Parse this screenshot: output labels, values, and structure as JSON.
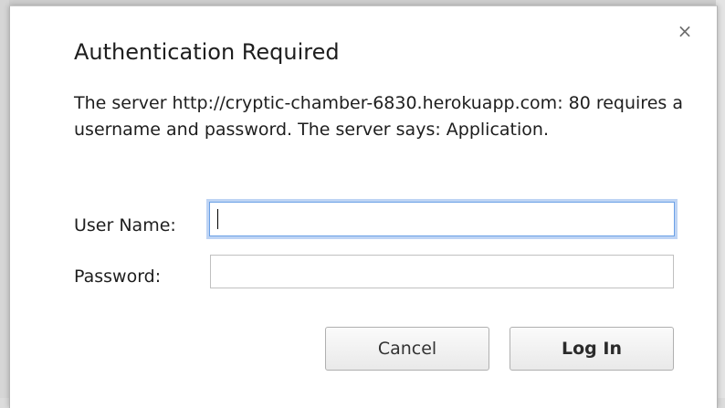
{
  "dialog": {
    "title": "Authentication Required",
    "close_icon": "×",
    "message": "The server http://cryptic-chamber-6830.herokuapp.com: 80 requires a username and password. The server says: Application."
  },
  "form": {
    "username_label": "User Name:",
    "username_value": "",
    "password_label": "Password:",
    "password_value": ""
  },
  "buttons": {
    "cancel": "Cancel",
    "login": "Log In"
  },
  "colors": {
    "focus_ring": "#6aa0e6",
    "dialog_bg": "#ffffff"
  }
}
